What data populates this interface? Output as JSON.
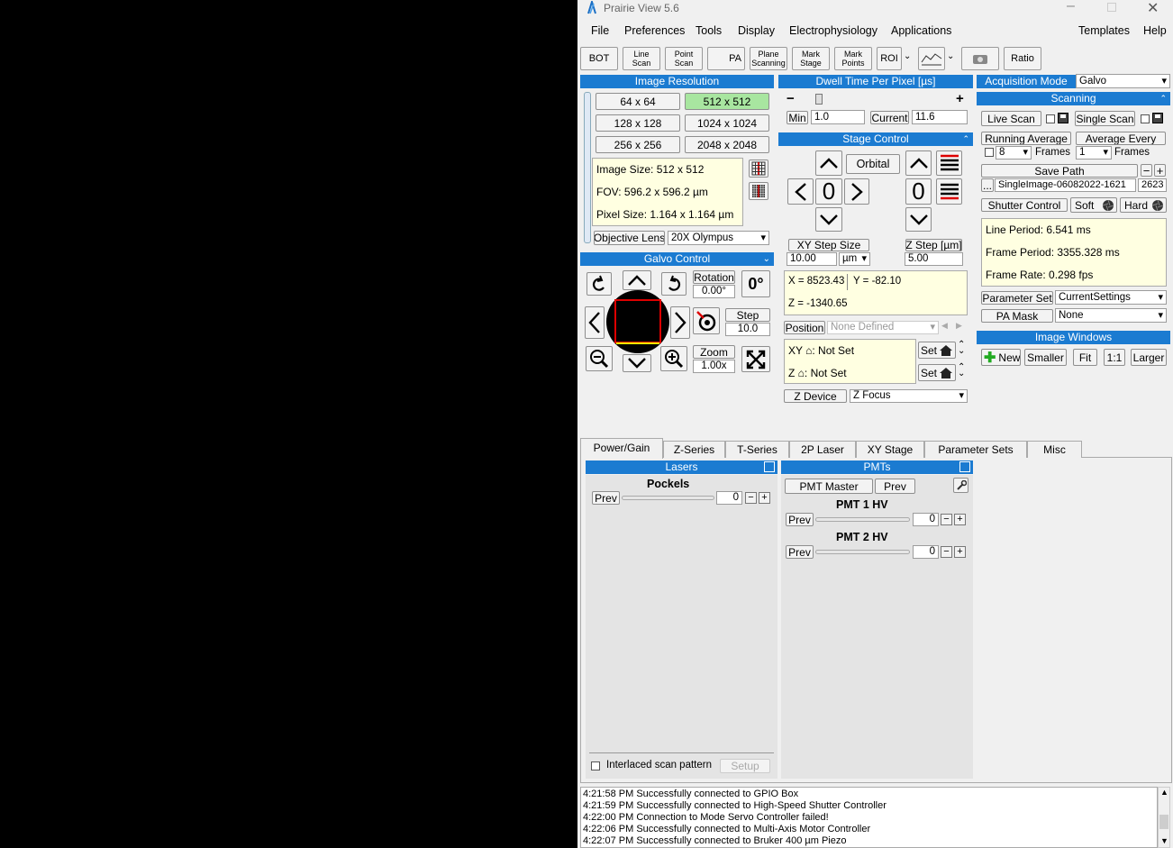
{
  "app": {
    "title": "Prairie View 5.6"
  },
  "menu": [
    "File",
    "Preferences",
    "Tools",
    "Display",
    "Electrophysiology",
    "Applications",
    "Templates",
    "Help"
  ],
  "toolbar": {
    "bot": "BOT",
    "line_scan": "Line Scan",
    "point_scan": "Point Scan",
    "pa": "PA",
    "plane_scanning": "Plane Scanning",
    "mark_stage": "Mark Stage",
    "mark_points": "Mark Points",
    "roi": "ROI",
    "ratio": "Ratio"
  },
  "image_resolution": {
    "header": "Image Resolution",
    "options": [
      "64 x 64",
      "512 x 512",
      "128 x 128",
      "1024 x 1024",
      "256 x 256",
      "2048 x 2048"
    ],
    "selected": "512 x 512",
    "image_size": "Image Size: 512 x 512",
    "fov": "FOV: 596.2 x 596.2 µm",
    "pixel_size": "Pixel Size: 1.164 x 1.164 µm",
    "objective_label": "Objective Lens",
    "objective_value": "20X Olympus"
  },
  "dwell": {
    "header": "Dwell Time Per Pixel [µs]",
    "minus": "−",
    "plus": "+",
    "min_label": "Min",
    "min_value": "1.0",
    "current_label": "Current",
    "current_value": "11.6"
  },
  "acq": {
    "label": "Acquisition Mode",
    "value": "Galvo"
  },
  "scanning": {
    "header": "Scanning",
    "live_scan": "Live Scan",
    "single_scan": "Single Scan",
    "running_average": "Running Average",
    "average_every": "Average Every",
    "ra_value": "8",
    "ae_value": "1",
    "frames": "Frames",
    "save_path": "Save Path",
    "ellipsis": "...",
    "path_value": "SingleImage-06082022-1621",
    "path_num": "2623",
    "shutter_control": "Shutter Control",
    "soft": "Soft",
    "hard": "Hard",
    "line_period": "Line Period: 6.541 ms",
    "frame_period": "Frame Period: 3355.328 ms",
    "frame_rate": "Frame Rate: 0.298 fps",
    "parameter_set_label": "Parameter Set",
    "parameter_set_value": "CurrentSettings",
    "pa_mask_label": "PA Mask",
    "pa_mask_value": "None"
  },
  "image_windows": {
    "header": "Image Windows",
    "new": "New",
    "smaller": "Smaller",
    "fit": "Fit",
    "one": "1:1",
    "larger": "Larger"
  },
  "stage": {
    "header": "Stage Control",
    "orbital": "Orbital",
    "zero": "0",
    "xy_step_label": "XY Step Size",
    "xy_step_value": "10.00",
    "xy_unit": "µm",
    "z_step_label": "Z Step [µm]",
    "z_step_value": "5.00",
    "x": "X = 8523.43",
    "y": "Y = -82.10",
    "z": "Z = -1340.65",
    "position_label": "Position",
    "position_value": "None Defined",
    "xy_home": "XY ⌂:  Not Set",
    "z_home": "Z ⌂:  Not Set",
    "set": "Set",
    "z_device_label": "Z Device",
    "z_device_value": "Z Focus"
  },
  "galvo": {
    "header": "Galvo Control",
    "rotation_label": "Rotation",
    "rotation_value": "0.00°",
    "degree": "0°",
    "step_label": "Step",
    "step_value": "10.0",
    "zoom_label": "Zoom",
    "zoom_value": "1.00x"
  },
  "tabs": [
    "Power/Gain",
    "Z-Series",
    "T-Series",
    "2P Laser",
    "XY Stage",
    "Parameter Sets",
    "Misc"
  ],
  "lasers": {
    "header": "Lasers",
    "pockels": "Pockels",
    "prev": "Prev",
    "value": "0",
    "interlaced": "Interlaced scan pattern",
    "setup": "Setup"
  },
  "pmts": {
    "header": "PMTs",
    "pmt_master": "PMT Master",
    "prev": "Prev",
    "pmt1": "PMT 1 HV",
    "pmt2": "PMT 2 HV",
    "pmt1_value": "0",
    "pmt2_value": "0"
  },
  "log": [
    "4:21:58 PM Successfully connected to GPIO Box",
    "4:21:59 PM Successfully connected to High-Speed Shutter Controller",
    "4:22:00 PM Connection to Mode Servo Controller failed!",
    "4:22:06 PM Successfully connected to Multi-Axis Motor Controller",
    "4:22:07 PM Successfully connected to Bruker 400 µm Piezo"
  ],
  "colors": {
    "header_blue": "#1b7bd1",
    "selected_green": "#a8e6a0",
    "info_yellow": "#ffffe1"
  }
}
